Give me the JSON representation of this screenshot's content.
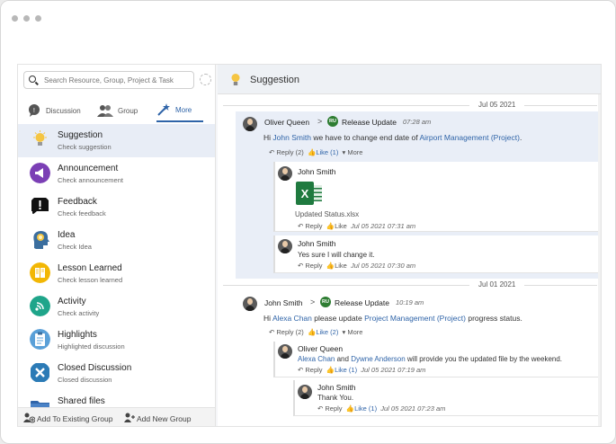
{
  "search": {
    "placeholder": "Search Resource, Group, Project & Task"
  },
  "tabs": [
    {
      "label": "Discussion"
    },
    {
      "label": "Group"
    },
    {
      "label": "More"
    }
  ],
  "menu": [
    {
      "title": "Suggestion",
      "sub": "Check suggestion",
      "color": "#f5c542",
      "glyph": "bulb-icon"
    },
    {
      "title": "Announcement",
      "sub": "Check announcement",
      "color": "#7b3fb5",
      "glyph": "megaphone-icon"
    },
    {
      "title": "Feedback",
      "sub": "Check feedback",
      "color": "#111111",
      "glyph": "feedback-icon"
    },
    {
      "title": "Idea",
      "sub": "Check Idea",
      "color": "#f0a830",
      "glyph": "idea-head-icon"
    },
    {
      "title": "Lesson Learned",
      "sub": "Check lesson learned",
      "color": "#f2b705",
      "glyph": "book-icon"
    },
    {
      "title": "Activity",
      "sub": "Check activity",
      "color": "#1fa58a",
      "glyph": "activity-icon"
    },
    {
      "title": "Highlights",
      "sub": "Highlighted discussion",
      "color": "#5aa0d8",
      "glyph": "clipboard-icon"
    },
    {
      "title": "Closed Discussion",
      "sub": "Closed discussion",
      "color": "#2c7bb6",
      "glyph": "close-box-icon"
    },
    {
      "title": "Shared files",
      "sub": "",
      "color": "#2f64a8",
      "glyph": "folder-icon"
    }
  ],
  "footer": {
    "add_existing": "Add To Existing Group",
    "add_new": "Add New Group"
  },
  "header": {
    "title": "Suggestion"
  },
  "threads": [
    {
      "date": "Jul 05 2021",
      "author": "Oliver Queen",
      "badge": "RU",
      "channel": "Release Update",
      "time": "07:28 am",
      "msg_pre": "Hi",
      "mention": "John Smith",
      "msg_mid": "we have to change end date of",
      "project": "Airport Management (Project)",
      "msg_post": ".",
      "reply_count": "Reply (2)",
      "like_count": "Like (1)",
      "more": "More",
      "replies": [
        {
          "author": "John Smith",
          "file": "Updated Status.xlsx",
          "reply": "Reply",
          "like": "Like",
          "time": "Jul 05 2021 07:31 am"
        },
        {
          "author": "John Smith",
          "text": "Yes sure I will change it.",
          "reply": "Reply",
          "like": "Like",
          "time": "Jul 05 2021 07:30 am"
        }
      ]
    },
    {
      "date": "Jul 01 2021",
      "author": "John Smith",
      "badge": "RU",
      "channel": "Release Update",
      "time": "10:19 am",
      "msg_pre": "Hi",
      "mention": "Alexa Chan",
      "msg_mid": "please update",
      "project": "Project Management (Project)",
      "msg_post": "progress status.",
      "reply_count": "Reply (2)",
      "like_count": "Like (2)",
      "more": "More",
      "replies": [
        {
          "author": "Oliver Queen",
          "mention1": "Alexa Chan",
          "and": "and",
          "mention2": "Dywne Anderson",
          "text": "will provide you the updated file by the weekend.",
          "reply": "Reply",
          "like": "Like (1)",
          "time": "Jul 05 2021 07:19 am"
        },
        {
          "author": "John Smith",
          "text": "Thank You.",
          "reply": "Reply",
          "like": "Like (1)",
          "time": "Jul 05 2021 07:23 am"
        }
      ]
    }
  ]
}
